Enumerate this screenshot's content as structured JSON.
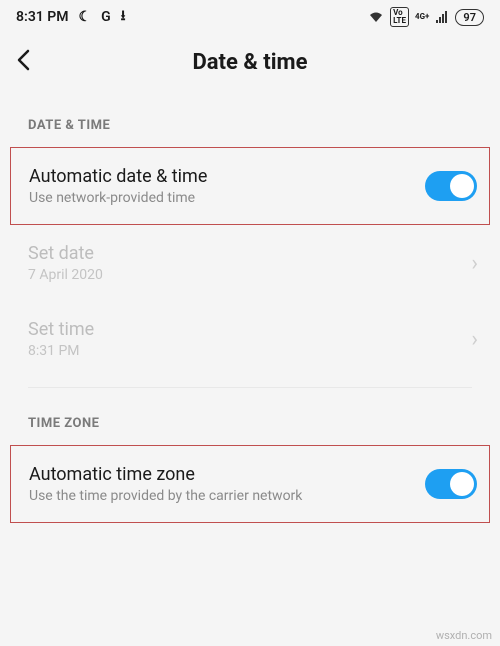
{
  "status": {
    "time": "8:31 PM",
    "moon_icon": "☾",
    "g_icon": "G",
    "download_icon": "⭳",
    "wifi_icon": "wifi",
    "lte_badge": "LTE",
    "net_label": "4G+",
    "battery": "97"
  },
  "header": {
    "title": "Date & time"
  },
  "sections": {
    "datetime_header": "DATE & TIME",
    "auto_datetime": {
      "title": "Automatic date & time",
      "subtitle": "Use network-provided time",
      "enabled": true
    },
    "set_date": {
      "title": "Set date",
      "subtitle": "7 April 2020"
    },
    "set_time": {
      "title": "Set time",
      "subtitle": "8:31 PM"
    },
    "timezone_header": "TIME ZONE",
    "auto_timezone": {
      "title": "Automatic time zone",
      "subtitle": "Use the time provided by the carrier network",
      "enabled": true
    }
  },
  "watermark": "wsxdn.com"
}
